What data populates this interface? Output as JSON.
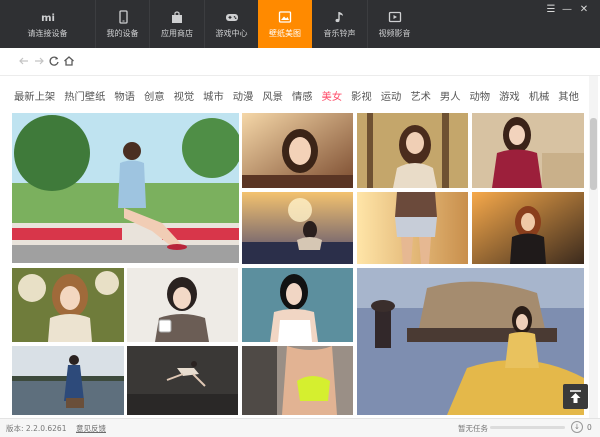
{
  "tabs": [
    {
      "label": "请连接设备",
      "icon": "mi-logo-icon"
    },
    {
      "label": "我的设备",
      "icon": "phone-icon"
    },
    {
      "label": "应用商店",
      "icon": "store-bag-icon"
    },
    {
      "label": "游戏中心",
      "icon": "gamepad-icon"
    },
    {
      "label": "壁纸美图",
      "icon": "wallpaper-icon",
      "active": true
    },
    {
      "label": "音乐铃声",
      "icon": "music-note-icon"
    },
    {
      "label": "视频影音",
      "icon": "video-player-icon"
    }
  ],
  "window_controls": {
    "menu": "☰",
    "minimize": "—",
    "close": "✕"
  },
  "nav": {
    "back": "back-arrow-icon",
    "forward": "forward-arrow-icon",
    "refresh": "refresh-icon",
    "home": "home-icon"
  },
  "categories": [
    "最新上架",
    "热门壁纸",
    "物语",
    "创意",
    "视觉",
    "城市",
    "动漫",
    "风景",
    "情感",
    "美女",
    "影视",
    "运动",
    "艺术",
    "男人",
    "动物",
    "游戏",
    "机械",
    "其他"
  ],
  "active_category": "美女",
  "status": {
    "version": "版本: 2.2.0.6261",
    "feedback": "意见反馈",
    "task": "暂无任务",
    "count": "0"
  },
  "colors": {
    "topbar": "#2f3033",
    "accent": "#ff8a00",
    "active_category": "#ff4d6a"
  },
  "wallpapers": [
    {
      "id": "girl-sitting-park"
    },
    {
      "id": "girl-sunset-portrait"
    },
    {
      "id": "girl-forest-sunlight"
    },
    {
      "id": "girl-red-top"
    },
    {
      "id": "girl-silhouette-lake"
    },
    {
      "id": "girl-denim-shorts-sun"
    },
    {
      "id": "girl-black-dress-field"
    },
    {
      "id": "girl-floral-knit"
    },
    {
      "id": "girl-short-hair-cup"
    },
    {
      "id": "girl-white-tank"
    },
    {
      "id": "girl-golden-gown-sofa"
    },
    {
      "id": "girl-lake-dress"
    },
    {
      "id": "dancer-dark-studio"
    },
    {
      "id": "girl-neon-swimsuit"
    }
  ]
}
